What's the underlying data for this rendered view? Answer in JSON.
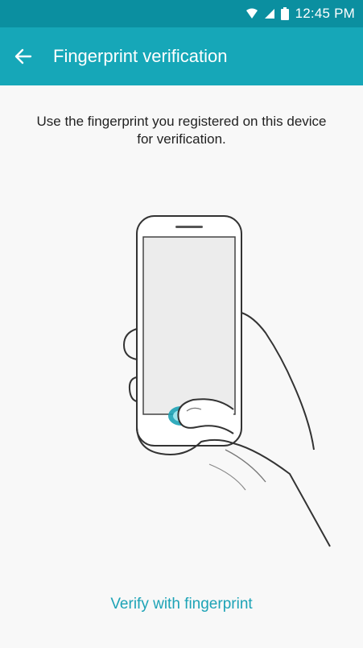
{
  "status_bar": {
    "time": "12:45 PM",
    "icons": [
      "wifi-icon",
      "signal-icon",
      "battery-icon"
    ]
  },
  "app_bar": {
    "title": "Fingerprint verification",
    "back_icon": "arrow-left-icon"
  },
  "content": {
    "instruction": "Use the fingerprint you registered on this device for verification.",
    "illustration": "fingerprint-hand-illustration"
  },
  "footer": {
    "verify_label": "Verify with fingerprint"
  },
  "colors": {
    "status_bar_bg": "#0b8fa0",
    "app_bar_bg": "#16a7b8",
    "accent": "#1da3b6",
    "background": "#f8f8f8"
  }
}
